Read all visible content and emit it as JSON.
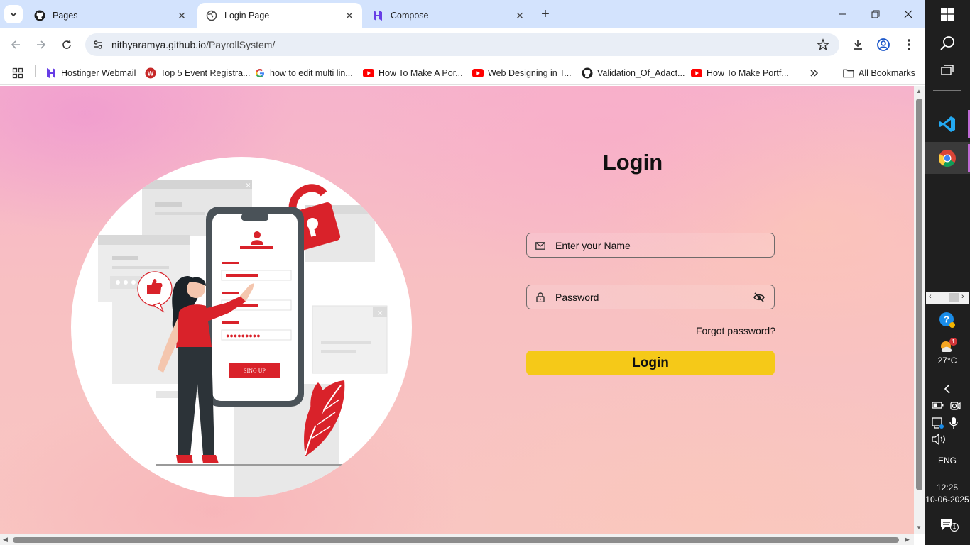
{
  "tabs": [
    {
      "title": "Pages",
      "icon": "github-icon",
      "active": false
    },
    {
      "title": "Login Page",
      "icon": "globe-icon",
      "active": true
    },
    {
      "title": "Compose",
      "icon": "hostinger-icon",
      "active": false
    }
  ],
  "address_bar": {
    "host": "nithyaramya.github.io",
    "path": "/PayrollSystem/"
  },
  "bookmarks": [
    {
      "label": "Hostinger Webmail",
      "icon": "hostinger-icon"
    },
    {
      "label": "Top 5 Event Registra...",
      "icon": "w-icon"
    },
    {
      "label": "how to edit multi lin...",
      "icon": "google-icon"
    },
    {
      "label": "How To Make A Por...",
      "icon": "youtube-icon"
    },
    {
      "label": "Web Designing in T...",
      "icon": "youtube-icon"
    },
    {
      "label": "Validation_Of_Adact...",
      "icon": "github-icon"
    },
    {
      "label": "How To Make Portf...",
      "icon": "youtube-icon"
    }
  ],
  "all_bookmarks_label": "All Bookmarks",
  "page": {
    "title": "Login",
    "name_placeholder": "Enter your Name",
    "password_placeholder": "Password",
    "forgot_label": "Forgot password?",
    "login_button": "Login",
    "illustration": {
      "signup_label": "SING UP"
    }
  },
  "colors": {
    "accent_button": "#f5c918",
    "illustration_red": "#d9222a",
    "tabstrip": "#d3e3fd"
  },
  "taskbar": {
    "temperature": "27°C",
    "weather_badge": "1",
    "language": "ENG",
    "time": "12:25",
    "date": "10-06-2025",
    "notifications_count": "1"
  }
}
